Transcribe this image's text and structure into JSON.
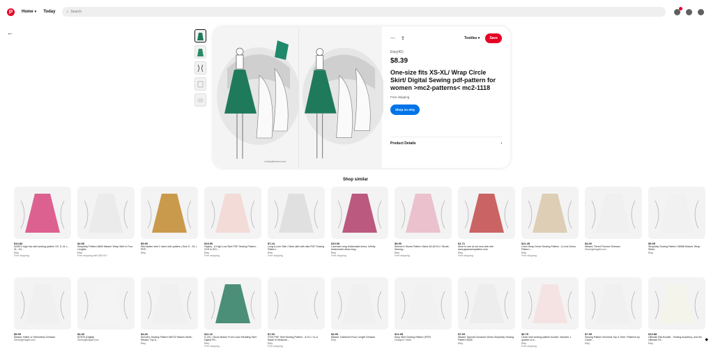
{
  "header": {
    "logo": "P",
    "home": "Home",
    "today": "Today",
    "search_placeholder": "Search"
  },
  "pin": {
    "board": "Textiles",
    "save": "Save",
    "seller": "Etsy(42)",
    "price": "$8.39",
    "title": "One-size fits XS-XL/ Wrap Circle Skirt/ Digital Sewing pdf-pattern for women >mc2-patterns< mc2-1118",
    "shipping": "Free shipping",
    "shop_button": "Shop on etsy",
    "details_label": "Product Details",
    "watermark": "mc2patterns.com"
  },
  "shop_similar": "Shop similar",
  "row1": [
    {
      "price": "$13.86",
      "title": "ASKEV high low skirt sewing pattern XS, S, M, L, XL, XX...",
      "seller": "Etsy",
      "ship": "Free shipping",
      "color": "#d8467e"
    },
    {
      "price": "$4.55",
      "title": "Simplicity Pattern 8800 Misses' Wrap Skirt in Four Lengths",
      "seller": "Etsy",
      "ship": "Free shipping with $35.00+",
      "color": "#e9e9e9"
    },
    {
      "price": "$5.90",
      "title": "Mini skater skirt 2 sizes skirt pattern | Size S - 3X | PDF...",
      "seller": "Etsy",
      "ship": "",
      "color": "#c2892e"
    },
    {
      "price": "$19.50",
      "title": "Hayley - A High Low Skirt PDF Sewing Pattern - XXS to 5XL...",
      "seller": "Etsy",
      "ship": "Free shipping",
      "color": "#f2d6d2"
    },
    {
      "price": "$7.24",
      "title": "Long A-Line Skirt / Maxi skirt with slits PDF Sewing Pattern...",
      "seller": "Etsy",
      "ship": "Free shipping",
      "color": "#dcdcdc"
    },
    {
      "price": "$10.00",
      "title": "Lavender long bridesmaid dress, Infinity bridesmaid dress long...",
      "seller": "Etsy",
      "ship": "Free shipping",
      "color": "#b23d6a"
    },
    {
      "price": "$5.50",
      "title": "Women's Skorts Pattern Sizes 36-48 EU / Skorts Sewing...",
      "seller": "Etsy",
      "ship": "Free shipping",
      "color": "#e8b7c5"
    },
    {
      "price": "$1.71",
      "title": "More to see at our new web site www.japansewpattern.com",
      "seller": "Etsy",
      "ship": "Free shipping",
      "color": "#c24a4a"
    },
    {
      "price": "$11.45",
      "title": "Linen Wrap Dress Sewing Pattern - A-Line Dress Pattern...",
      "seller": "Etsy",
      "ship": "Free shipping",
      "color": "#d9c7aa"
    },
    {
      "price": "$4.00",
      "title": "Misses' Tiered Flounce Dresses",
      "seller": "Sewingforagift.com",
      "ship": "",
      "color": "#efefef"
    },
    {
      "price": "$5.95",
      "title": "Simplicity Sewing Pattern S8968 Misses' Wrap Skirts",
      "seller": "Etsy",
      "ship": "",
      "color": "#f0f0f0"
    }
  ],
  "row2": [
    {
      "price": "$5.99",
      "title": "Misses' Halter or Sleeveless Dresses",
      "seller": "Sewingforagift.com",
      "ship": "",
      "color": "#efefef"
    },
    {
      "price": "$4.49",
      "title": "M7876 (Digital)",
      "seller": "Sewingforagift.com",
      "ship": "",
      "color": "#f3f3f3"
    },
    {
      "price": "$4.00",
      "title": "McCall's Sewing Pattern M8722 Misses Skirts - Misses' Top &...",
      "seller": "Etsy",
      "ship": "",
      "color": "#efefef"
    },
    {
      "price": "$11.16",
      "title": "S-2XL / Snow Button Front Lace Wedding Skirt Digital PD...",
      "seller": "Etsy",
      "ship": "Free shipping",
      "color": "#2e7d62"
    },
    {
      "price": "$7.93",
      "title": "S700 PDF Skirt Sewing Pattern - 8-10 L XL & Made to Measure...",
      "seller": "Etsy",
      "ship": "Free shipping",
      "color": "#f1f1f1"
    },
    {
      "price": "$4.99",
      "title": "Misses' Gathered Floor Length Dresses",
      "seller": "Etsy",
      "ship": "",
      "color": "#efefef"
    },
    {
      "price": "$12.95",
      "title": "Kacy Skirt Sewing Pattern (PDF)",
      "seller": "Designer Stitch",
      "ship": "",
      "color": "#f0f0f0"
    },
    {
      "price": "$7.69",
      "title": "Misses' Special Occasion Dress Simplicity Sewing Pattern 8328",
      "seller": "Etsy",
      "ship": "",
      "color": "#ebebeb"
    },
    {
      "price": "$6.75",
      "title": "Circle skirt sewing pattern bundle: includes 1 quarter of a...",
      "seller": "Etsy",
      "ship": "Free shipping",
      "color": "#f4dfe0"
    },
    {
      "price": "$7.95",
      "title": "Sewing Pattern Womens Top & Skirt / Patterns by Carrie...",
      "seller": "Etsy",
      "ship": "",
      "color": "#efefef"
    },
    {
      "price": "$13.88",
      "title": "Ultimate Ella Bundle - Sewing Academy, and the Ultimate Fit...",
      "seller": "Etsy",
      "ship": "",
      "color": "#f3f3e8"
    }
  ]
}
